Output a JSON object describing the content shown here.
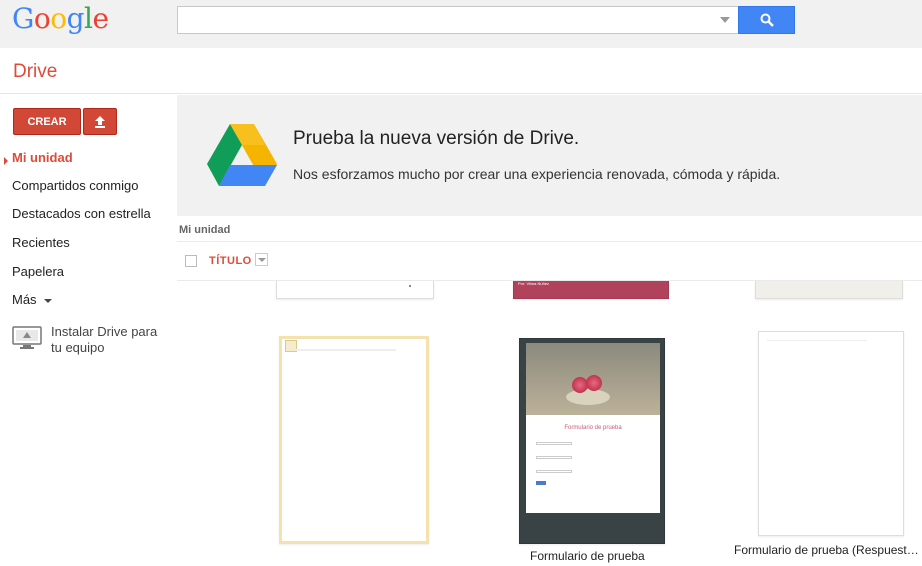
{
  "header": {
    "logo_letters": [
      {
        "ch": "G",
        "color": "#4285f4"
      },
      {
        "ch": "o",
        "color": "#ea4335"
      },
      {
        "ch": "o",
        "color": "#fbbc05"
      },
      {
        "ch": "g",
        "color": "#4285f4"
      },
      {
        "ch": "l",
        "color": "#34a853"
      },
      {
        "ch": "e",
        "color": "#ea4335"
      }
    ],
    "search_value": "",
    "search_icon": "search-icon"
  },
  "app": {
    "title": "Drive"
  },
  "sidebar": {
    "create_label": "CREAR",
    "upload_icon": "upload-icon",
    "items": [
      {
        "label": "Mi unidad"
      },
      {
        "label": "Compartidos conmigo"
      },
      {
        "label": "Destacados con estrella"
      },
      {
        "label": "Recientes"
      },
      {
        "label": "Papelera"
      },
      {
        "label": "Más"
      }
    ],
    "install": {
      "label": "Instalar Drive para tu equipo",
      "icon": "monitor-icon"
    }
  },
  "promo": {
    "title": "Prueba la nueva versión de Drive.",
    "text": "Nos esforzamos mucho por crear una experiencia renovada, cómoda y rápida."
  },
  "list": {
    "breadcrumb": "Mi unidad",
    "column_title": "TÍTULO"
  },
  "files": [
    {
      "caption": ""
    },
    {
      "caption": "Formulario de prueba"
    },
    {
      "caption": "Formulario de prueba (Respuest…"
    }
  ],
  "thumb_text": {
    "partial_center": "Por: Vilma Núñez",
    "form_title": "Formulario de prueba"
  },
  "colors": {
    "brand_red": "#dd4b39",
    "button_red": "#d14836",
    "search_blue": "#4285f4"
  }
}
